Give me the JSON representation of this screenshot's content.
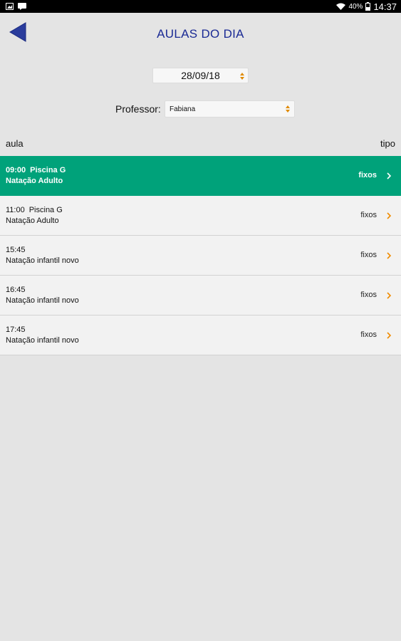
{
  "status_bar": {
    "battery": "40%",
    "clock": "14:37",
    "icons": [
      "image-icon",
      "message-icon",
      "wifi-icon",
      "battery-icon"
    ]
  },
  "header": {
    "title": "AULAS DO DIA",
    "back_icon": "back-arrow-icon"
  },
  "filters": {
    "date": "28/09/18",
    "professor_label": "Professor:",
    "professor_value": "Fabiana"
  },
  "columns": {
    "aula": "aula",
    "tipo": "tipo"
  },
  "classes": [
    {
      "time": "09:00",
      "location": "Piscina G",
      "name": "Natação Adulto",
      "type": "fixos",
      "selected": true
    },
    {
      "time": "11:00",
      "location": "Piscina G",
      "name": "Natação Adulto",
      "type": "fixos",
      "selected": false
    },
    {
      "time": "15:45",
      "location": "",
      "name": "Natação infantil novo",
      "type": "fixos",
      "selected": false
    },
    {
      "time": "16:45",
      "location": "",
      "name": "Natação infantil novo",
      "type": "fixos",
      "selected": false
    },
    {
      "time": "17:45",
      "location": "",
      "name": "Natação infantil novo",
      "type": "fixos",
      "selected": false
    }
  ],
  "colors": {
    "accent": "#00a27a",
    "title": "#1a2a94",
    "chevron": "#f08c00",
    "background": "#e4e4e4"
  }
}
